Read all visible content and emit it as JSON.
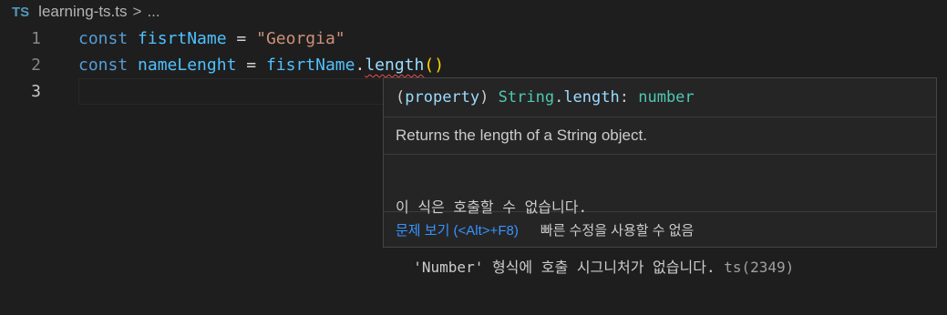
{
  "breadcrumb": {
    "lang_badge": "TS",
    "file": "learning-ts.ts",
    "separator": ">",
    "more": "..."
  },
  "editor": {
    "lines": [
      {
        "number": "1",
        "tokens": [
          {
            "text": "const",
            "kind": "keyword"
          },
          {
            "text": "fisrtName",
            "kind": "variable"
          },
          {
            "text": "=",
            "kind": "operator"
          },
          {
            "text": "\"Georgia\"",
            "kind": "string"
          }
        ]
      },
      {
        "number": "2",
        "tokens": [
          {
            "text": "const",
            "kind": "keyword"
          },
          {
            "text": "nameLenght",
            "kind": "variable"
          },
          {
            "text": "=",
            "kind": "operator"
          },
          {
            "text": "fisrtName",
            "kind": "variable"
          },
          {
            "text": ".",
            "kind": "operator"
          },
          {
            "text": "length",
            "kind": "property"
          },
          {
            "text": "()",
            "kind": "paren"
          }
        ]
      },
      {
        "number": "3",
        "tokens": []
      }
    ]
  },
  "hover": {
    "signature": {
      "open": "(",
      "kind": "property",
      "close": ")",
      "type": "String",
      "dot": ".",
      "prop": "length",
      "colon": ":",
      "return_type": "number"
    },
    "doc": "Returns the length of a String object.",
    "error_line1": "이 식은 호출할 수 없습니다.",
    "error_line2": "  'Number' 형식에 호출 시그니처가 없습니다.",
    "error_code": "ts(2349)",
    "view_problem": "문제 보기 (<Alt>+F8)",
    "no_quick_fix": "빠른 수정을 사용할 수 없음"
  },
  "colors": {
    "background": "#1e1e1e",
    "keyword": "#569cd6",
    "variable": "#4fc1ff",
    "string": "#ce9178",
    "error_squiggle": "#f14c4c",
    "link": "#3794ff"
  }
}
